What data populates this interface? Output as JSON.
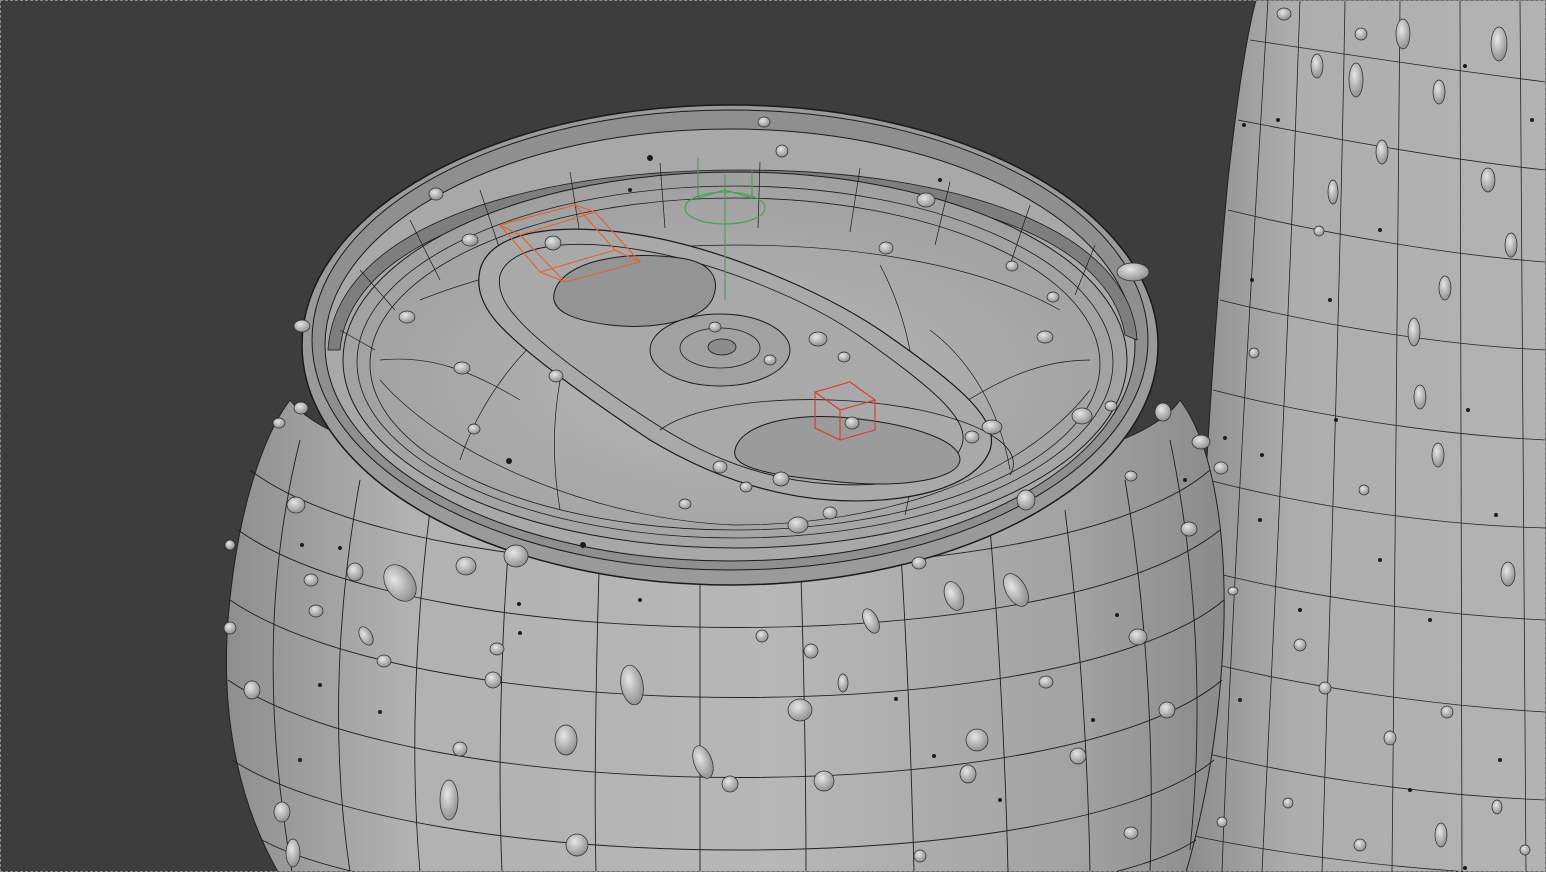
{
  "viewport": {
    "mode": "wireframe-overlay",
    "background_color": "#3d3d3d",
    "mesh_color": "#a7a7a7",
    "wire_color": "#1e1e1e",
    "empty_color_orange": "#e3622f",
    "empty_color_red": "#d63a2a",
    "empty_color_green": "#3fa34a"
  },
  "objects": [
    {
      "name": "can-foreground",
      "kind": "mesh"
    },
    {
      "name": "can-background",
      "kind": "mesh"
    },
    {
      "name": "condensation-droplets",
      "kind": "mesh"
    },
    {
      "name": "tab-empty-orange",
      "kind": "empty"
    },
    {
      "name": "tab-empty-red",
      "kind": "empty"
    },
    {
      "name": "origin-empty-green",
      "kind": "empty"
    }
  ]
}
